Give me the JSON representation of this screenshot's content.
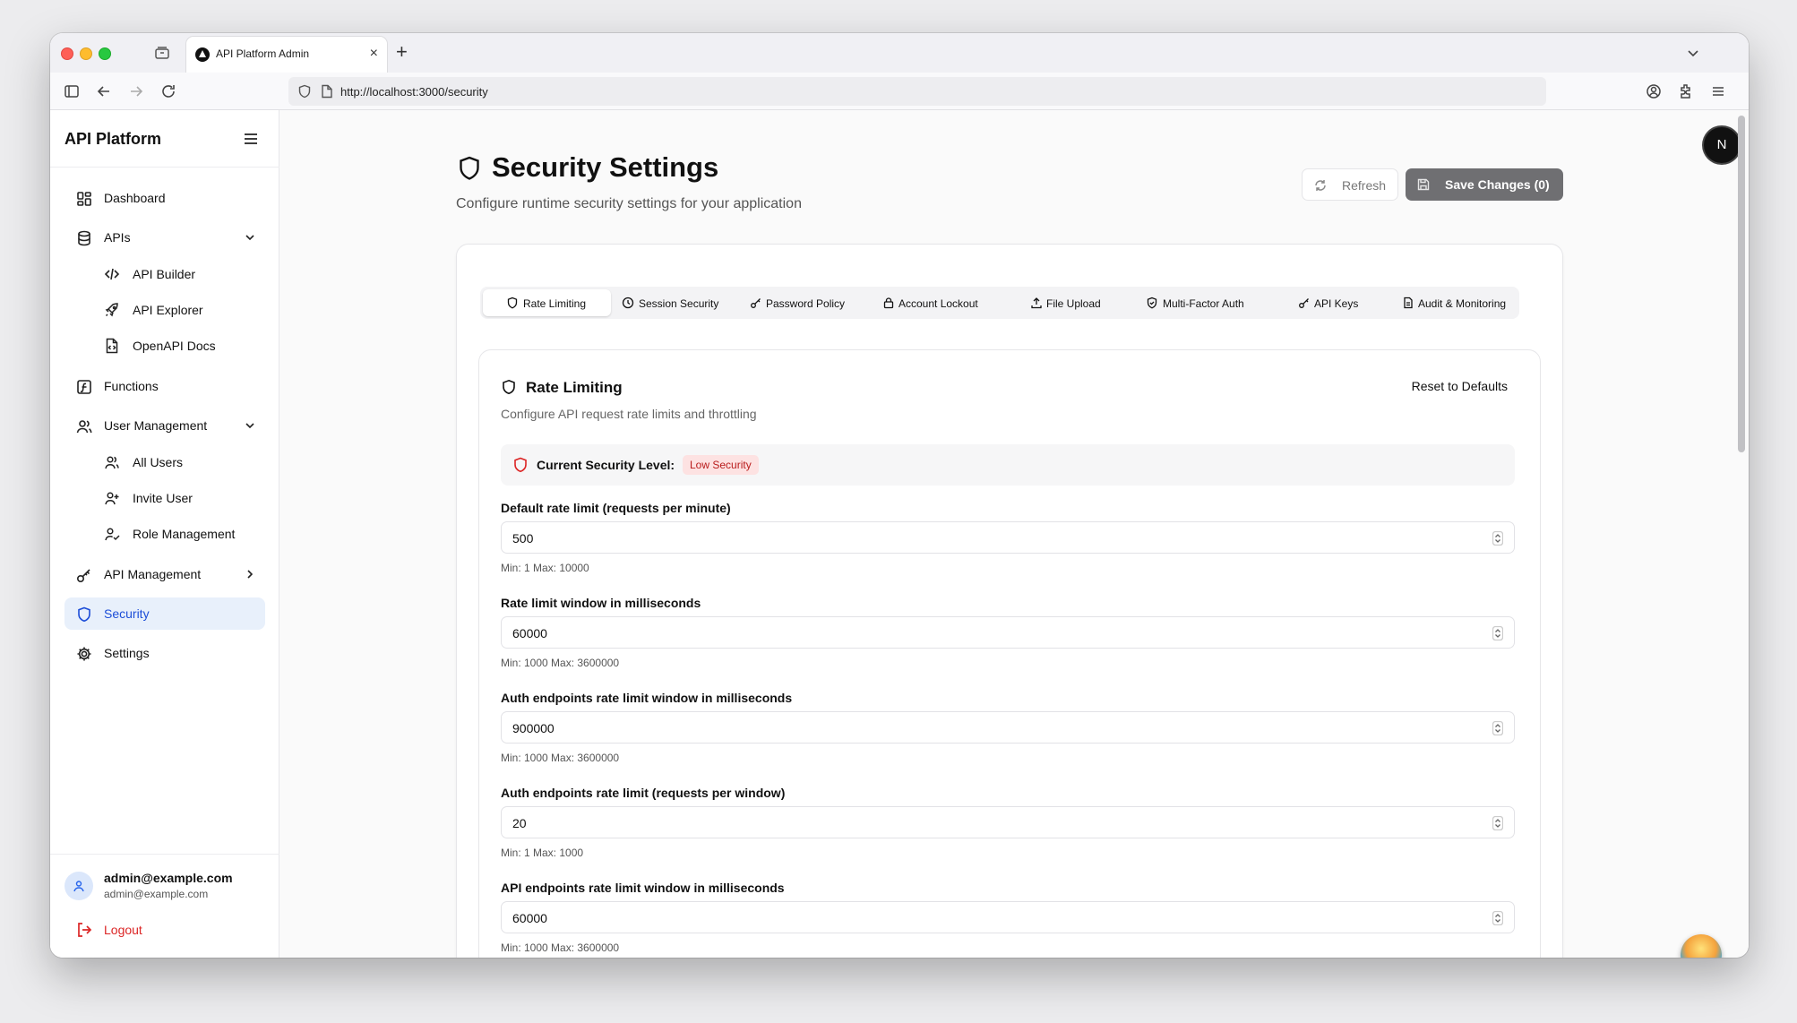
{
  "browser": {
    "tab_title": "API Platform Admin",
    "url": "http://localhost:3000/security"
  },
  "sidebar": {
    "brand": "API Platform",
    "items": [
      {
        "label": "Dashboard",
        "icon": "dashboard-icon"
      },
      {
        "label": "APIs",
        "icon": "database-icon"
      },
      {
        "label": "API Builder",
        "icon": "code-icon"
      },
      {
        "label": "API Explorer",
        "icon": "rocket-icon"
      },
      {
        "label": "OpenAPI Docs",
        "icon": "file-code-icon"
      },
      {
        "label": "Functions",
        "icon": "function-icon"
      },
      {
        "label": "User Management",
        "icon": "users-icon"
      },
      {
        "label": "All Users",
        "icon": "users-icon"
      },
      {
        "label": "Invite User",
        "icon": "user-plus-icon"
      },
      {
        "label": "Role Management",
        "icon": "user-check-icon"
      },
      {
        "label": "API Management",
        "icon": "key-icon"
      },
      {
        "label": "Security",
        "icon": "shield-icon"
      },
      {
        "label": "Settings",
        "icon": "gear-icon"
      }
    ],
    "user": {
      "name": "admin@example.com",
      "email": "admin@example.com"
    },
    "logout": "Logout"
  },
  "header": {
    "title": "Security Settings",
    "subtitle": "Configure runtime security settings for your application",
    "refresh": "Refresh",
    "save": "Save Changes (0)",
    "avatar_letter": "N"
  },
  "tabs": [
    {
      "label": "Rate Limiting",
      "icon": "shield-icon"
    },
    {
      "label": "Session Security",
      "icon": "clock-icon"
    },
    {
      "label": "Password Policy",
      "icon": "key-icon"
    },
    {
      "label": "Account Lockout",
      "icon": "lock-icon"
    },
    {
      "label": "File Upload",
      "icon": "upload-icon"
    },
    {
      "label": "Multi-Factor Auth",
      "icon": "shield-check-icon"
    },
    {
      "label": "API Keys",
      "icon": "key-icon"
    },
    {
      "label": "Audit & Monitoring",
      "icon": "file-text-icon"
    }
  ],
  "section": {
    "title": "Rate Limiting",
    "description": "Configure API request rate limits and throttling",
    "reset": "Reset to Defaults",
    "level_label": "Current Security Level:",
    "level_badge": "Low Security",
    "fields": [
      {
        "label": "Default rate limit (requests per minute)",
        "value": "500",
        "hint": "Min: 1 Max: 10000"
      },
      {
        "label": "Rate limit window in milliseconds",
        "value": "60000",
        "hint": "Min: 1000 Max: 3600000"
      },
      {
        "label": "Auth endpoints rate limit window in milliseconds",
        "value": "900000",
        "hint": "Min: 1000 Max: 3600000"
      },
      {
        "label": "Auth endpoints rate limit (requests per window)",
        "value": "20",
        "hint": "Min: 1 Max: 1000"
      },
      {
        "label": "API endpoints rate limit window in milliseconds",
        "value": "60000",
        "hint": "Min: 1000 Max: 3600000"
      }
    ]
  },
  "colors": {
    "accent": "#1d4ed8",
    "active_bg": "#e8f0fb",
    "danger": "#dc2626",
    "badge_bg": "#fde2e2",
    "save_bg": "#6f6f72"
  }
}
